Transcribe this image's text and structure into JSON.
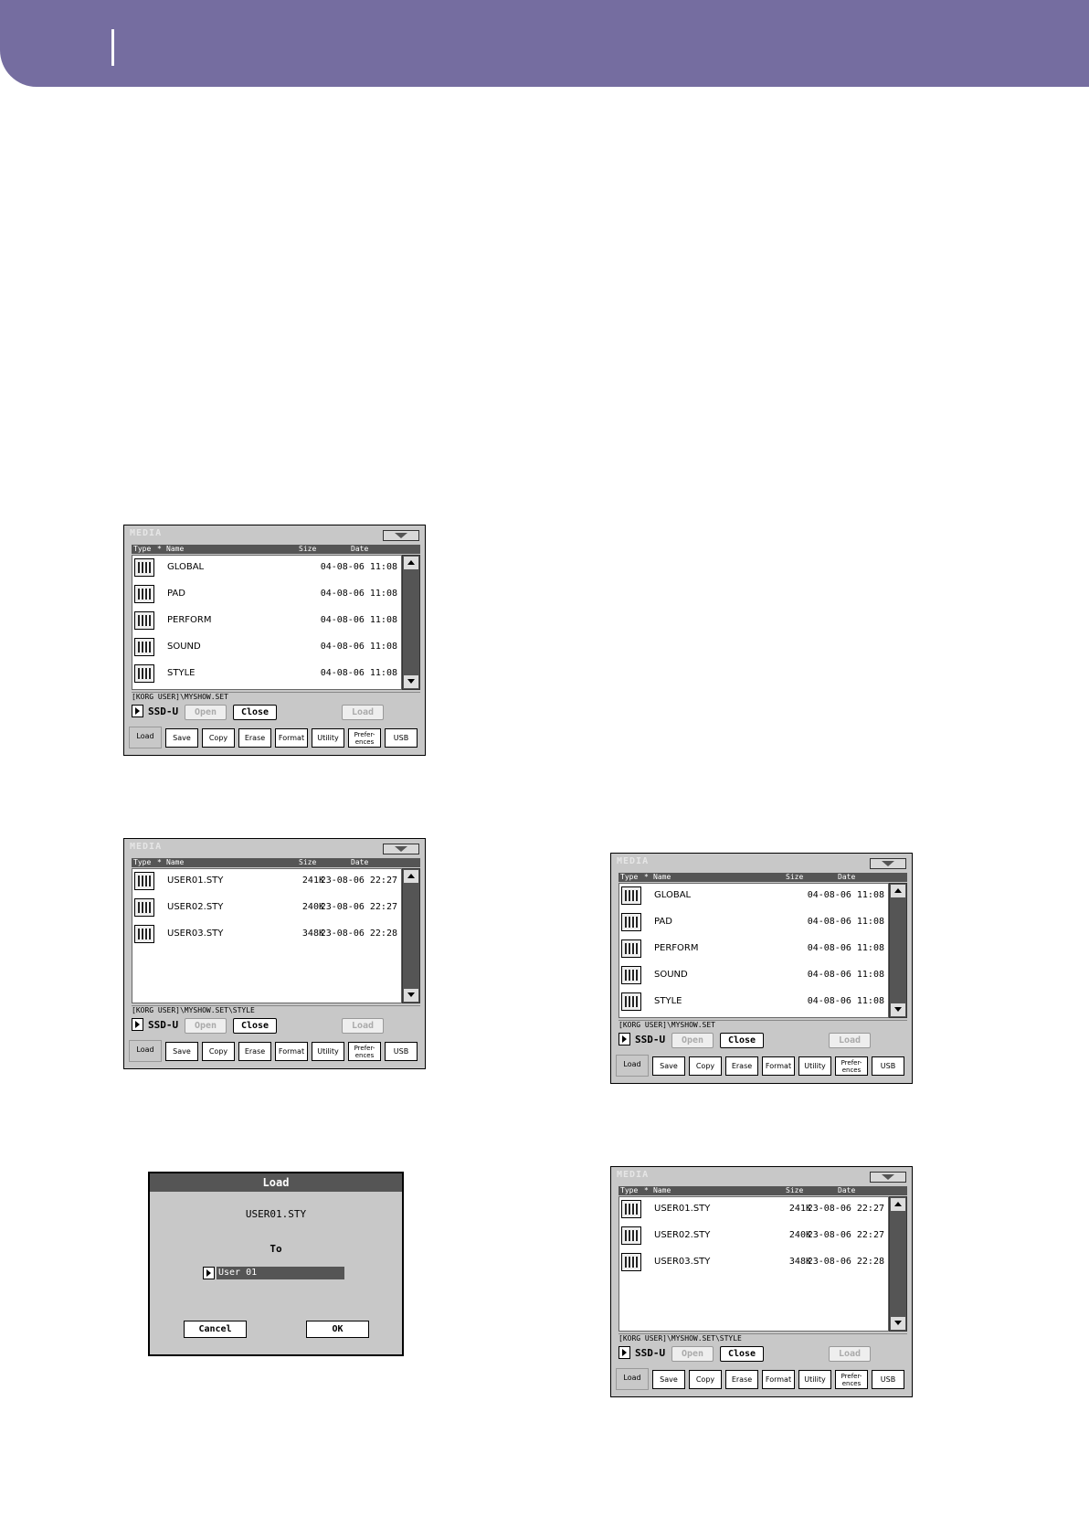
{
  "screens": [
    {
      "title": "MEDIA",
      "columns": {
        "type": "Type",
        "star": "*",
        "name": "Name",
        "size": "Size",
        "date": "Date"
      },
      "rows": [
        {
          "icon": "global-folder-icon",
          "name": "GLOBAL",
          "size": "",
          "date": "04-08-06 11:08"
        },
        {
          "icon": "pad-folder-icon",
          "name": "PAD",
          "size": "",
          "date": "04-08-06 11:08"
        },
        {
          "icon": "perform-folder-icon",
          "name": "PERFORM",
          "size": "",
          "date": "04-08-06 11:08"
        },
        {
          "icon": "sound-folder-icon",
          "name": "SOUND",
          "size": "",
          "date": "04-08-06 11:08"
        },
        {
          "icon": "style-folder-icon",
          "name": "STYLE",
          "size": "",
          "date": "04-08-06 11:08"
        }
      ],
      "path": "[KORG USER]\\MYSHOW.SET",
      "device": "SSD-U",
      "buttons": {
        "open": "Open",
        "close": "Close",
        "load": "Load"
      },
      "tabs": [
        "Load",
        "Save",
        "Copy",
        "Erase",
        "Format",
        "Utility",
        "Prefer-\nences",
        "USB"
      ]
    },
    {
      "title": "MEDIA",
      "columns": {
        "type": "Type",
        "star": "*",
        "name": "Name",
        "size": "Size",
        "date": "Date"
      },
      "rows": [
        {
          "icon": "style-file-icon",
          "name": "USER01.STY",
          "size": "241K",
          "date": "23-08-06 22:27"
        },
        {
          "icon": "style-file-icon",
          "name": "USER02.STY",
          "size": "240K",
          "date": "23-08-06 22:27"
        },
        {
          "icon": "style-file-icon",
          "name": "USER03.STY",
          "size": "348K",
          "date": "23-08-06 22:28"
        }
      ],
      "path": "[KORG USER]\\MYSHOW.SET\\STYLE",
      "device": "SSD-U",
      "buttons": {
        "open": "Open",
        "close": "Close",
        "load": "Load"
      },
      "tabs": [
        "Load",
        "Save",
        "Copy",
        "Erase",
        "Format",
        "Utility",
        "Prefer-\nences",
        "USB"
      ]
    },
    {
      "title": "MEDIA",
      "columns": {
        "type": "Type",
        "star": "*",
        "name": "Name",
        "size": "Size",
        "date": "Date"
      },
      "rows": [
        {
          "icon": "global-folder-icon",
          "name": "GLOBAL",
          "size": "",
          "date": "04-08-06 11:08"
        },
        {
          "icon": "pad-folder-icon",
          "name": "PAD",
          "size": "",
          "date": "04-08-06 11:08"
        },
        {
          "icon": "perform-folder-icon",
          "name": "PERFORM",
          "size": "",
          "date": "04-08-06 11:08"
        },
        {
          "icon": "sound-folder-icon",
          "name": "SOUND",
          "size": "",
          "date": "04-08-06 11:08"
        },
        {
          "icon": "style-folder-icon",
          "name": "STYLE",
          "size": "",
          "date": "04-08-06 11:08"
        }
      ],
      "path": "[KORG USER]\\MYSHOW.SET",
      "device": "SSD-U",
      "buttons": {
        "open": "Open",
        "close": "Close",
        "load": "Load"
      },
      "tabs": [
        "Load",
        "Save",
        "Copy",
        "Erase",
        "Format",
        "Utility",
        "Prefer-\nences",
        "USB"
      ]
    },
    {
      "title": "MEDIA",
      "columns": {
        "type": "Type",
        "star": "*",
        "name": "Name",
        "size": "Size",
        "date": "Date"
      },
      "rows": [
        {
          "icon": "style-file-icon",
          "name": "USER01.STY",
          "size": "241K",
          "date": "23-08-06 22:27"
        },
        {
          "icon": "style-file-icon",
          "name": "USER02.STY",
          "size": "240K",
          "date": "23-08-06 22:27"
        },
        {
          "icon": "style-file-icon",
          "name": "USER03.STY",
          "size": "348K",
          "date": "23-08-06 22:28"
        }
      ],
      "path": "[KORG USER]\\MYSHOW.SET\\STYLE",
      "device": "SSD-U",
      "buttons": {
        "open": "Open",
        "close": "Close",
        "load": "Load"
      },
      "tabs": [
        "Load",
        "Save",
        "Copy",
        "Erase",
        "Format",
        "Utility",
        "Prefer-\nences",
        "USB"
      ]
    }
  ],
  "load_dialog": {
    "title": "Load",
    "file": "USER01.STY",
    "to_label": "To",
    "target": "User 01",
    "cancel": "Cancel",
    "ok": "OK"
  },
  "colors": {
    "header": "#756da0"
  }
}
